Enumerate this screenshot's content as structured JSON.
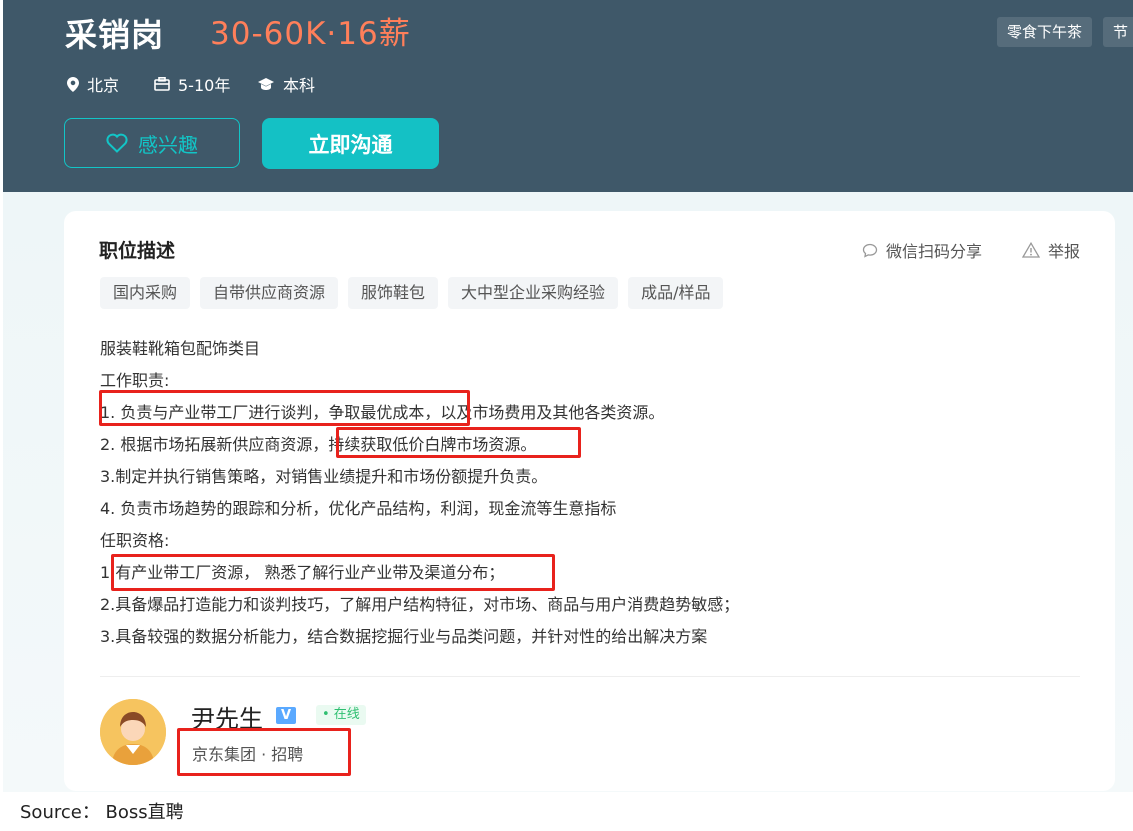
{
  "header": {
    "title": "采销岗",
    "salary": "30-60K·16薪",
    "benefit_tags": [
      "零食下午茶",
      "节"
    ],
    "meta": {
      "city": "北京",
      "experience": "5-10年",
      "education": "本科"
    },
    "interest_label": "感兴趣",
    "chat_label": "立即沟通"
  },
  "job": {
    "section_title": "职位描述",
    "share_label": "微信扫码分享",
    "report_label": "举报",
    "tags": [
      "国内采购",
      "自带供应商资源",
      "服饰鞋包",
      "大中型企业采购经验",
      "成品/样品"
    ],
    "lines": [
      "服装鞋靴箱包配饰类目",
      "工作职责:",
      "1. 负责与产业带工厂进行谈判，争取最优成本，以及市场费用及其他各类资源。",
      "2. 根据市场拓展新供应商资源，持续获取低价白牌市场资源。",
      "3.制定并执行销售策略，对销售业绩提升和市场份额提升负责。",
      "4. 负责市场趋势的跟踪和分析，优化产品结构，利润，现金流等生意指标",
      "任职资格:",
      "1.有产业带工厂资源， 熟悉了解行业产业带及渠道分布；",
      "2.具备爆品打造能力和谈判技巧，了解用户结构特征，对市场、商品与用户消费趋势敏感；",
      "3.具备较强的数据分析能力，结合数据挖掘行业与品类问题，并针对性的给出解决方案"
    ]
  },
  "recruiter": {
    "name": "尹先生",
    "verified": "V",
    "status": "• 在线",
    "company": "京东集团 · 招聘"
  },
  "caption": "Source： Boss直聘",
  "colors": {
    "header_bg": "#3f5869",
    "accent": "#14c1c5",
    "salary": "#ff7f5a",
    "highlight": "#e8221c"
  }
}
